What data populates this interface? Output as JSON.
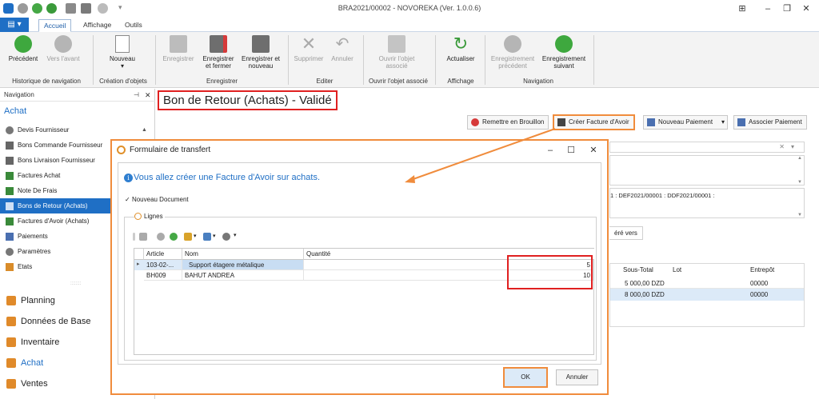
{
  "window": {
    "title": "BRA2021/00002 - NOVOREKA (Ver. 1.0.0.6)"
  },
  "ribbon_tabs": [
    "Accueil",
    "Affichage",
    "Outils"
  ],
  "ribbon": {
    "precedent": "Précédent",
    "vers_avant": "Vers l'avant",
    "grp_historique": "Historique de navigation",
    "nouveau": "Nouveau",
    "grp_creation": "Création d'objets",
    "enregistrer": "Enregistrer",
    "enregistrer_fermer": "Enregistrer et fermer",
    "enregistrer_nouveau": "Enregistrer et nouveau",
    "grp_enregistrer": "Enregistrer",
    "supprimer": "Supprimer",
    "annuler": "Annuler",
    "grp_editer": "Editer",
    "ouvrir_objet": "Ouvrir l'objet associé",
    "grp_ouvrir": "Ouvrir l'objet associé",
    "actualiser": "Actualiser",
    "grp_affichage": "Affichage",
    "enr_precedent": "Enregistrement précédent",
    "enr_suivant": "Enregistrement suivant",
    "grp_navigation": "Navigation"
  },
  "sidebar": {
    "header": "Navigation",
    "section": "Achat",
    "items": [
      "Devis Fournisseur",
      "Bons Commande Fournisseur",
      "Bons Livraison Fournisseur",
      "Factures Achat",
      "Note De Frais",
      "Bons de Retour (Achats)",
      "Factures d'Avoir (Achats)",
      "Paiements",
      "Paramètres",
      "Etats"
    ],
    "groups": [
      "Planning",
      "Données de Base",
      "Inventaire",
      "Achat",
      "Ventes"
    ]
  },
  "main": {
    "title": "Bon de Retour (Achats) - Validé",
    "buttons": {
      "remettre": "Remettre en Brouillon",
      "creer_avoir": "Créer Facture d'Avoir",
      "nouveau_paiement": "Nouveau Paiement",
      "associer_paiement": "Associer Paiement"
    },
    "ref_text": "1 : DEF2021/00001 : DDF2021/00001 :",
    "tab_fragment": "éré vers",
    "bg_grid": {
      "columns": [
        "Sous-Total",
        "Lot",
        "Entrepôt"
      ],
      "rows": [
        [
          "5 000,00 DZD",
          "",
          "00000"
        ],
        [
          "8 000,00 DZD",
          "",
          "00000"
        ]
      ]
    }
  },
  "dialog": {
    "title": "Formulaire de transfert",
    "message": "Vous allez créer une Facture d'Avoir sur achats.",
    "checkbox_label": "Nouveau Document",
    "group_label": "Lignes",
    "columns": [
      "Article",
      "Nom",
      "Quantité"
    ],
    "rows": [
      {
        "article": "103-02-...",
        "nom": "Support étagere métalique",
        "quantite": "5"
      },
      {
        "article": "BH009",
        "nom": "BAHUT ANDREA",
        "quantite": "10"
      }
    ],
    "ok": "OK",
    "cancel": "Annuler"
  },
  "colors": {
    "accent": "#1f6fc5",
    "highlight_red": "#e02020",
    "highlight_orange": "#f08c3c"
  }
}
